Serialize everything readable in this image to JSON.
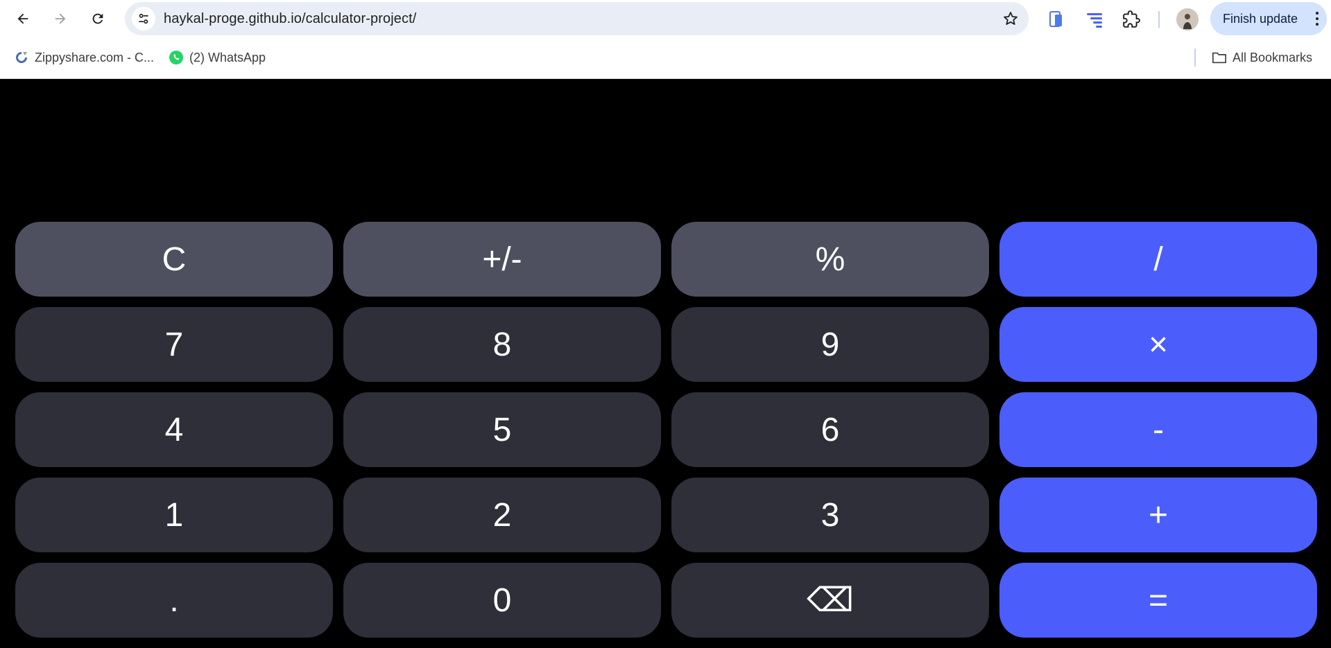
{
  "browser": {
    "url": "haykal-proge.github.io/calculator-project/",
    "finish_update_label": "Finish update",
    "icons": {
      "back": "arrow-left-icon",
      "forward": "arrow-right-icon",
      "reload": "reload-icon",
      "site_info": "tune-icon",
      "bookmark_star": "star-icon",
      "extensions": [
        "phone-extension-icon",
        "list-extension-icon",
        "puzzle-icon"
      ],
      "menu": "kebab-menu-icon"
    },
    "accent": "#d3e3fd"
  },
  "bookmarks": {
    "items": [
      {
        "label": "Zippyshare.com - C...",
        "icon": "zippyshare-icon"
      },
      {
        "label": "(2) WhatsApp",
        "icon": "whatsapp-icon"
      }
    ],
    "all_bookmarks_label": "All Bookmarks"
  },
  "calculator": {
    "display_value": "",
    "colors": {
      "background": "#000000",
      "function_key": "#4e505f",
      "number_key": "#2e2f38",
      "operator_key": "#4b5efc"
    },
    "keys": [
      {
        "label": "C",
        "type": "func",
        "name": "clear-button"
      },
      {
        "label": "+/-",
        "type": "func",
        "name": "sign-toggle-button"
      },
      {
        "label": "%",
        "type": "func",
        "name": "percent-button"
      },
      {
        "label": "/",
        "type": "op",
        "name": "divide-button"
      },
      {
        "label": "7",
        "type": "num",
        "name": "digit-7-button"
      },
      {
        "label": "8",
        "type": "num",
        "name": "digit-8-button"
      },
      {
        "label": "9",
        "type": "num",
        "name": "digit-9-button"
      },
      {
        "label": "×",
        "type": "op",
        "name": "multiply-button"
      },
      {
        "label": "4",
        "type": "num",
        "name": "digit-4-button"
      },
      {
        "label": "5",
        "type": "num",
        "name": "digit-5-button"
      },
      {
        "label": "6",
        "type": "num",
        "name": "digit-6-button"
      },
      {
        "label": "-",
        "type": "op",
        "name": "subtract-button"
      },
      {
        "label": "1",
        "type": "num",
        "name": "digit-1-button"
      },
      {
        "label": "2",
        "type": "num",
        "name": "digit-2-button"
      },
      {
        "label": "3",
        "type": "num",
        "name": "digit-3-button"
      },
      {
        "label": "+",
        "type": "op",
        "name": "add-button"
      },
      {
        "label": ".",
        "type": "num",
        "name": "decimal-button"
      },
      {
        "label": "0",
        "type": "num",
        "name": "digit-0-button"
      },
      {
        "label": "⌫",
        "type": "num",
        "name": "backspace-button"
      },
      {
        "label": "=",
        "type": "op",
        "name": "equals-button"
      }
    ]
  }
}
